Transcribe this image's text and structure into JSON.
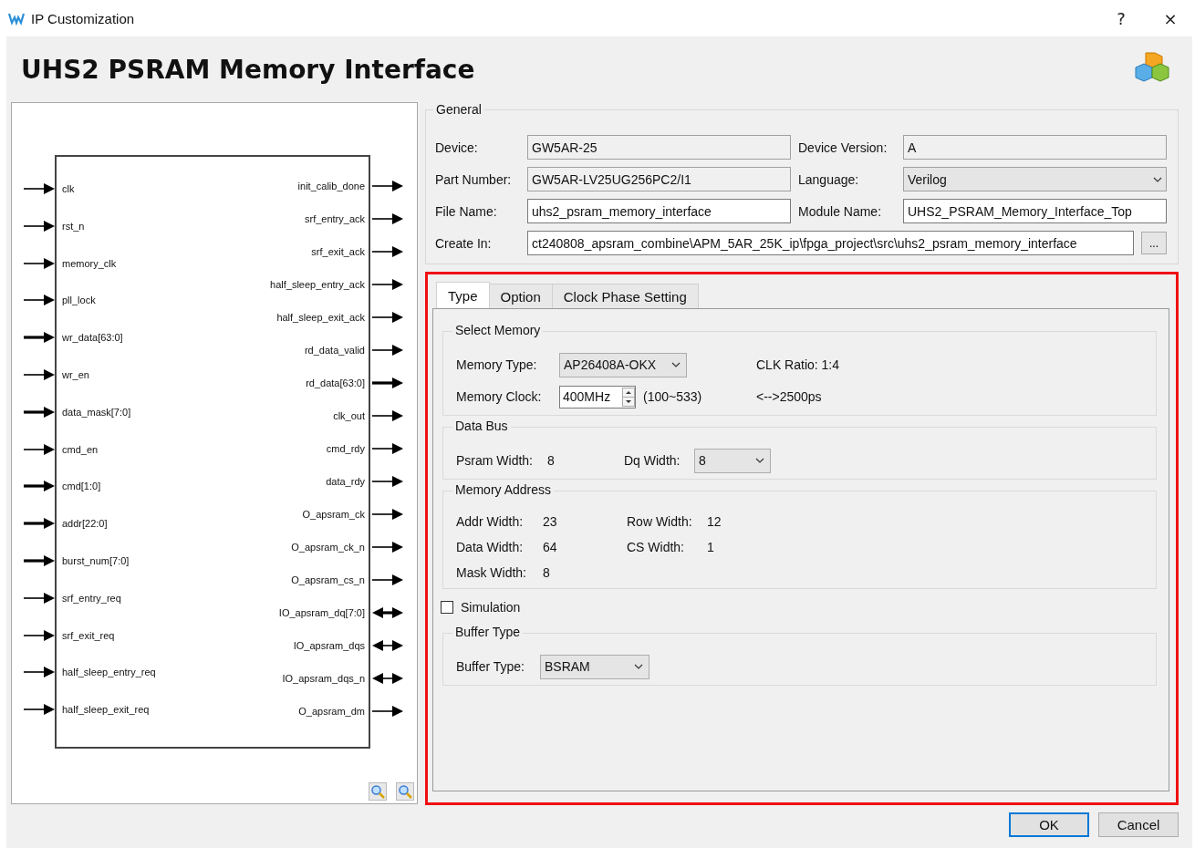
{
  "window": {
    "title": "IP Customization",
    "help": "?",
    "close": "×"
  },
  "header": {
    "title": "UHS2 PSRAM Memory Interface"
  },
  "diagram": {
    "inputs": [
      {
        "name": "clk",
        "bus": false
      },
      {
        "name": "rst_n",
        "bus": false
      },
      {
        "name": "memory_clk",
        "bus": false
      },
      {
        "name": "pll_lock",
        "bus": false
      },
      {
        "name": "wr_data[63:0]",
        "bus": true
      },
      {
        "name": "wr_en",
        "bus": false
      },
      {
        "name": "data_mask[7:0]",
        "bus": true
      },
      {
        "name": "cmd_en",
        "bus": false
      },
      {
        "name": "cmd[1:0]",
        "bus": true
      },
      {
        "name": "addr[22:0]",
        "bus": true
      },
      {
        "name": "burst_num[7:0]",
        "bus": true
      },
      {
        "name": "srf_entry_req",
        "bus": false
      },
      {
        "name": "srf_exit_req",
        "bus": false
      },
      {
        "name": "half_sleep_entry_req",
        "bus": false
      },
      {
        "name": "half_sleep_exit_req",
        "bus": false
      }
    ],
    "outputs": [
      {
        "name": "init_calib_done",
        "kind": "out",
        "bus": false
      },
      {
        "name": "srf_entry_ack",
        "kind": "out",
        "bus": false
      },
      {
        "name": "srf_exit_ack",
        "kind": "out",
        "bus": false
      },
      {
        "name": "half_sleep_entry_ack",
        "kind": "out",
        "bus": false
      },
      {
        "name": "half_sleep_exit_ack",
        "kind": "out",
        "bus": false
      },
      {
        "name": "rd_data_valid",
        "kind": "out",
        "bus": false
      },
      {
        "name": "rd_data[63:0]",
        "kind": "out",
        "bus": true
      },
      {
        "name": "clk_out",
        "kind": "out",
        "bus": false
      },
      {
        "name": "cmd_rdy",
        "kind": "out",
        "bus": false
      },
      {
        "name": "data_rdy",
        "kind": "out",
        "bus": false
      },
      {
        "name": "O_apsram_ck",
        "kind": "out",
        "bus": false
      },
      {
        "name": "O_apsram_ck_n",
        "kind": "out",
        "bus": false
      },
      {
        "name": "O_apsram_cs_n",
        "kind": "out",
        "bus": false
      },
      {
        "name": "IO_apsram_dq[7:0]",
        "kind": "inout",
        "bus": true
      },
      {
        "name": "IO_apsram_dqs",
        "kind": "inout",
        "bus": false
      },
      {
        "name": "IO_apsram_dqs_n",
        "kind": "inout",
        "bus": false
      },
      {
        "name": "O_apsram_dm",
        "kind": "out",
        "bus": false
      }
    ]
  },
  "general": {
    "title": "General",
    "rows": [
      [
        {
          "label": "Device:",
          "value": "GW5AR-25",
          "kind": "text",
          "readonly": true
        },
        {
          "label": "Device Version:",
          "value": "A",
          "kind": "text",
          "readonly": true
        }
      ],
      [
        {
          "label": "Part Number:",
          "value": "GW5AR-LV25UG256PC2/I1",
          "kind": "text",
          "readonly": true
        },
        {
          "label": "Language:",
          "value": "Verilog",
          "kind": "combo",
          "readonly": true
        }
      ],
      [
        {
          "label": "File Name:",
          "value": "uhs2_psram_memory_interface",
          "kind": "text",
          "readonly": false
        },
        {
          "label": "Module Name:",
          "value": "UHS2_PSRAM_Memory_Interface_Top",
          "kind": "text",
          "readonly": false
        }
      ],
      [
        {
          "label": "Create In:",
          "value": "ct240808_apsram_combine\\APM_5AR_25K_ip\\fpga_project\\src\\uhs2_psram_memory_interface",
          "kind": "browse",
          "readonly": false,
          "button": "..."
        }
      ]
    ]
  },
  "tabs": [
    {
      "label": "Type",
      "selected": true
    },
    {
      "label": "Option",
      "selected": false
    },
    {
      "label": "Clock Phase Setting",
      "selected": false
    }
  ],
  "tab_panel": {
    "highlighted": true,
    "items": [
      {
        "kind": "group",
        "title": "Select Memory",
        "rows": [
          [
            {
              "kind": "text",
              "text": "Memory Type:"
            },
            {
              "kind": "combo",
              "value": "AP26408A-OKX"
            },
            {
              "kind": "text",
              "text": ""
            },
            {
              "kind": "text",
              "text": "CLK Ratio: 1:4"
            }
          ],
          [
            {
              "kind": "text",
              "text": "Memory Clock:"
            },
            {
              "kind": "spin",
              "value": "400MHz"
            },
            {
              "kind": "text",
              "text": "(100~533)"
            },
            {
              "kind": "text",
              "text": "<-->2500ps"
            }
          ]
        ]
      },
      {
        "kind": "group",
        "title": "Data Bus",
        "rows": [
          [
            {
              "kind": "text",
              "text": "Psram Width:"
            },
            {
              "kind": "text",
              "text": "8"
            },
            {
              "kind": "text",
              "text": "Dq Width:"
            },
            {
              "kind": "combo",
              "value": "8"
            }
          ]
        ]
      },
      {
        "kind": "group",
        "title": "Memory Address",
        "rows": [
          [
            {
              "kind": "text",
              "text": "Addr Width:"
            },
            {
              "kind": "text",
              "text": "23"
            },
            {
              "kind": "text",
              "text": "Row Width:"
            },
            {
              "kind": "text",
              "text": "12"
            }
          ],
          [
            {
              "kind": "text",
              "text": "Data Width:"
            },
            {
              "kind": "text",
              "text": "64"
            },
            {
              "kind": "text",
              "text": "CS Width:"
            },
            {
              "kind": "text",
              "text": "1"
            }
          ],
          [
            {
              "kind": "text",
              "text": "Mask Width:"
            },
            {
              "kind": "text",
              "text": "8"
            }
          ]
        ]
      },
      {
        "kind": "checkbox",
        "label": "Simulation",
        "checked": false
      },
      {
        "kind": "group",
        "title": "Buffer Type",
        "rows": [
          [
            {
              "kind": "text",
              "text": "Buffer Type:"
            },
            {
              "kind": "combo",
              "value": "BSRAM"
            }
          ]
        ]
      }
    ]
  },
  "buttons": [
    {
      "label": "OK",
      "default": true
    },
    {
      "label": "Cancel",
      "default": false
    }
  ]
}
